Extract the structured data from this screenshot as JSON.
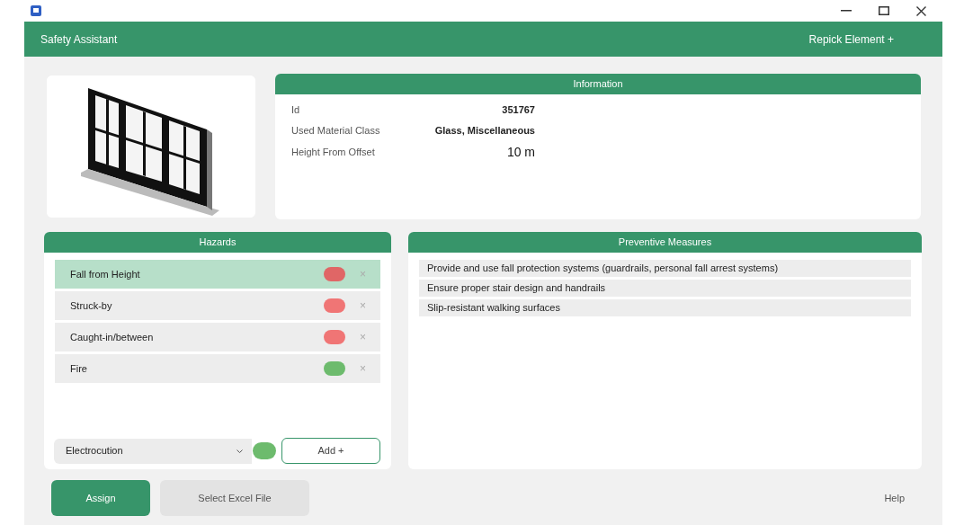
{
  "window": {
    "title": "Safety Assistant",
    "header_action": "Repick Element +"
  },
  "information": {
    "title": "Information",
    "fields": [
      {
        "label": "Id",
        "value": "351767",
        "kind": "bold"
      },
      {
        "label": "Used Material Class",
        "value": "Glass, Miscellaneous",
        "kind": "bold"
      },
      {
        "label": "Height From Offset",
        "value": "10 m",
        "kind": "large"
      }
    ]
  },
  "hazards": {
    "title": "Hazards",
    "items": [
      {
        "name": "Fall from Height",
        "color": "#e06666",
        "selected": true,
        "remove": "×"
      },
      {
        "name": "Struck-by",
        "color": "#f07575",
        "selected": false,
        "remove": "×"
      },
      {
        "name": "Caught-in/between",
        "color": "#f07575",
        "selected": false,
        "remove": "×"
      },
      {
        "name": "Fire",
        "color": "#6dbb6d",
        "selected": false,
        "remove": "×"
      }
    ],
    "new_hazard": {
      "value": "Electrocution",
      "color": "#6dbb6d"
    },
    "add_button": "Add +"
  },
  "preventive_measures": {
    "title": "Preventive Measures",
    "items": [
      "Provide and use fall protection systems (guardrails, personal fall arrest systems)",
      "Ensure proper stair design and handrails",
      "Slip-resistant walking surfaces"
    ]
  },
  "buttons": {
    "assign": "Assign",
    "select_file": "Select Excel File",
    "help": "Help"
  }
}
